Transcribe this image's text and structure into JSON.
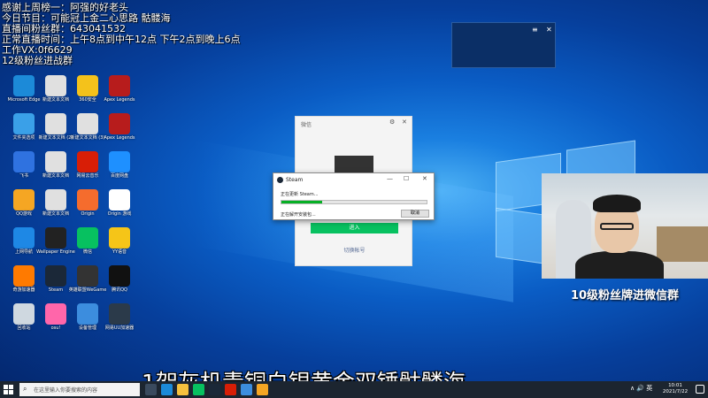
{
  "overlay": {
    "line1": "感谢上周榜一：阿强的好老头",
    "line2": "今日节目：可能冠上金二心思路 骷髅海",
    "line3": "直播间粉丝群：643041532",
    "line4": "正常直播时间：上午8点到中午12点 下午2点到晚上6点",
    "line5": "工作VX:0f6629",
    "line6": "12级粉丝进战群"
  },
  "desktop_icons": [
    {
      "label": "Microsoft Edge",
      "color": "#1c8ad8"
    },
    {
      "label": "新建文本文档",
      "color": "#e0e0e0"
    },
    {
      "label": "360安全",
      "color": "#f4c21b"
    },
    {
      "label": "Apex Legends",
      "color": "#b71c1c"
    },
    {
      "label": "文件夹选项",
      "color": "#3aa0e8"
    },
    {
      "label": "新建文本文档 (2)",
      "color": "#e0e0e0"
    },
    {
      "label": "新建文本文档 (3)",
      "color": "#e0e0e0"
    },
    {
      "label": "Apex Legends",
      "color": "#b71c1c"
    },
    {
      "label": "飞书",
      "color": "#2f72e0"
    },
    {
      "label": "新建文本文档",
      "color": "#e0e0e0"
    },
    {
      "label": "网易云音乐",
      "color": "#d81e06"
    },
    {
      "label": "百度网盘",
      "color": "#1e90ff"
    },
    {
      "label": "QQ游戏",
      "color": "#f5a623"
    },
    {
      "label": "新建文本文档",
      "color": "#e0e0e0"
    },
    {
      "label": "Origin",
      "color": "#f56c2d"
    },
    {
      "label": "Origin 游戏",
      "color": "#ffffff"
    },
    {
      "label": "上网导航",
      "color": "#1e88e5"
    },
    {
      "label": "Wallpaper Engine",
      "color": "#222222"
    },
    {
      "label": "微信",
      "color": "#07c160"
    },
    {
      "label": "YY语音",
      "color": "#f5c518"
    },
    {
      "label": "奇游加速器",
      "color": "#ff7a00"
    },
    {
      "label": "Steam",
      "color": "#1b2838"
    },
    {
      "label": "英雄联盟WeGame",
      "color": "#333333"
    },
    {
      "label": "腾讯QQ",
      "color": "#111111"
    },
    {
      "label": "回收站",
      "color": "#cfd8e0"
    },
    {
      "label": "osu!",
      "color": "#ff66aa"
    },
    {
      "label": "设备管理",
      "color": "#3c8dde"
    },
    {
      "label": "网易UU加速器",
      "color": "#2b3a4a"
    }
  ],
  "wechat": {
    "title": "微信",
    "settings": "⚙",
    "close": "✕",
    "enter_label": "进入",
    "switch_label": "切换帐号"
  },
  "steam_dialog": {
    "title": "Steam",
    "minimize": "—",
    "maximize": "☐",
    "close": "✕",
    "status1": "正在更新 Steam...",
    "status2": "正在解开安装包...",
    "progress": 0.28,
    "cancel_label": "取消"
  },
  "mini_widget": {
    "menu": "≡",
    "close": "✕"
  },
  "fan_group_label": "10级粉丝牌进微信群",
  "subtitle": "1架灰机青铜白银黄金双锤骷髅海",
  "taskbar": {
    "search_placeholder": "在这里输入你要搜索的内容",
    "time": "10:01",
    "date": "2021/7/22",
    "tray_icons": "∧ 🔊 英"
  }
}
